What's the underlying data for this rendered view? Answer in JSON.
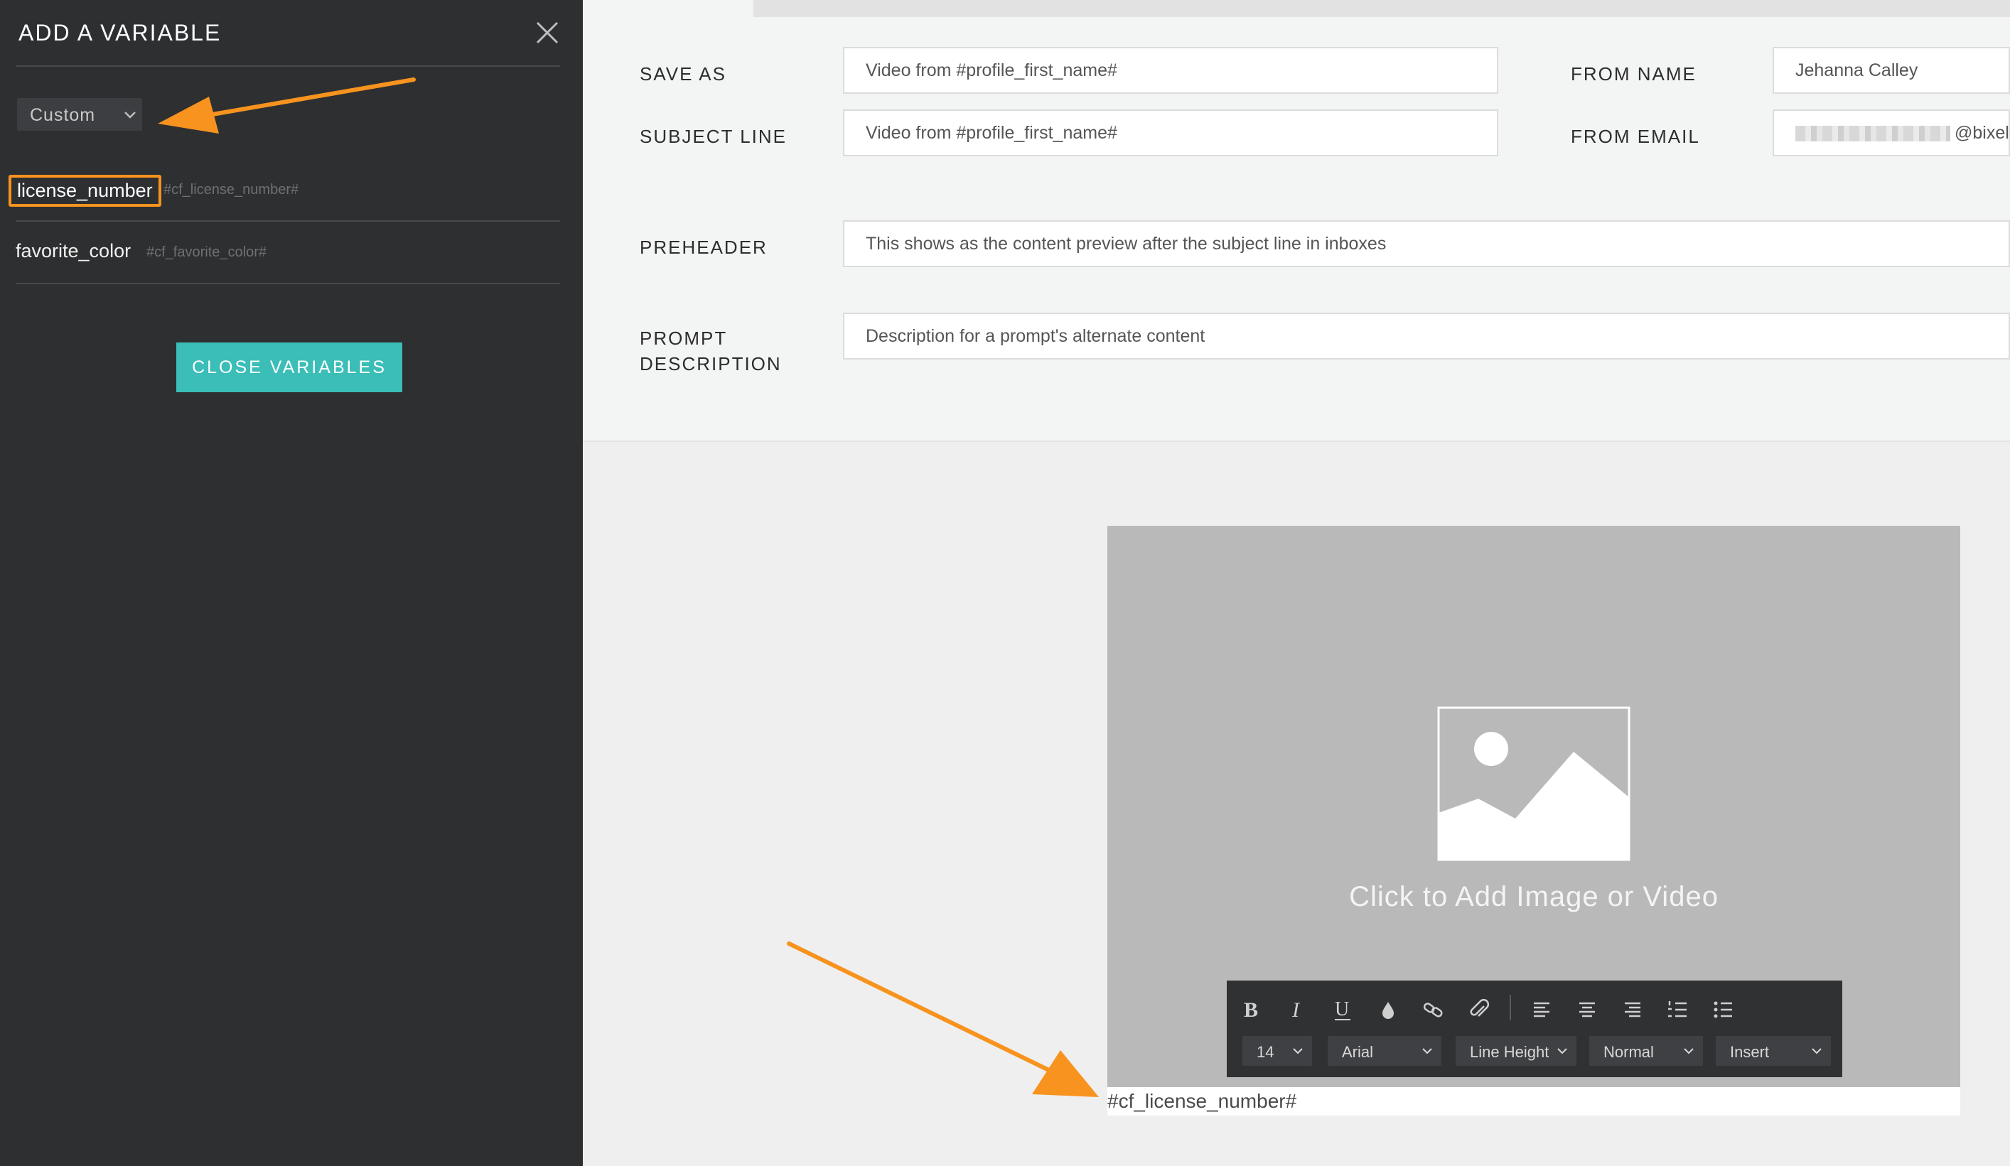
{
  "sidebar": {
    "title": "ADD A VARIABLE",
    "dropdown_value": "Custom",
    "variables": [
      {
        "name": "license_number",
        "code": "#cf_license_number#"
      },
      {
        "name": "favorite_color",
        "code": "#cf_favorite_color#"
      }
    ],
    "close_button": "CLOSE VARIABLES"
  },
  "form": {
    "save_as": {
      "label": "SAVE AS",
      "value": "Video from #profile_first_name#"
    },
    "subject_line": {
      "label": "SUBJECT LINE",
      "value": "Video from #profile_first_name#"
    },
    "from_name": {
      "label": "FROM NAME",
      "value": "Jehanna Calley"
    },
    "from_email": {
      "label": "FROM EMAIL",
      "value": "@bixel.i"
    },
    "preheader": {
      "label": "PREHEADER",
      "placeholder": "This shows as the content preview after the subject line in inboxes"
    },
    "prompt_description": {
      "label_line1": "PROMPT",
      "label_line2": "DESCRIPTION",
      "placeholder": "Description for a prompt's alternate content"
    }
  },
  "canvas": {
    "cta": "Click to Add Image or Video",
    "text_content": "#cf_license_number#"
  },
  "toolbar": {
    "icons": [
      "bold-icon",
      "italic-icon",
      "underline-icon",
      "color-drop-icon",
      "link-icon",
      "attachment-icon",
      "align-left-icon",
      "align-center-icon",
      "align-right-icon",
      "ordered-list-icon",
      "unordered-list-icon"
    ],
    "font_size": "14",
    "font_family": "Arial",
    "line_height": "Line Height",
    "paragraph_style": "Normal",
    "insert": "Insert"
  },
  "colors": {
    "sidebar_bg": "#2e2f31",
    "accent_teal": "#3bbdb8",
    "annotation_orange": "#f7931e"
  }
}
